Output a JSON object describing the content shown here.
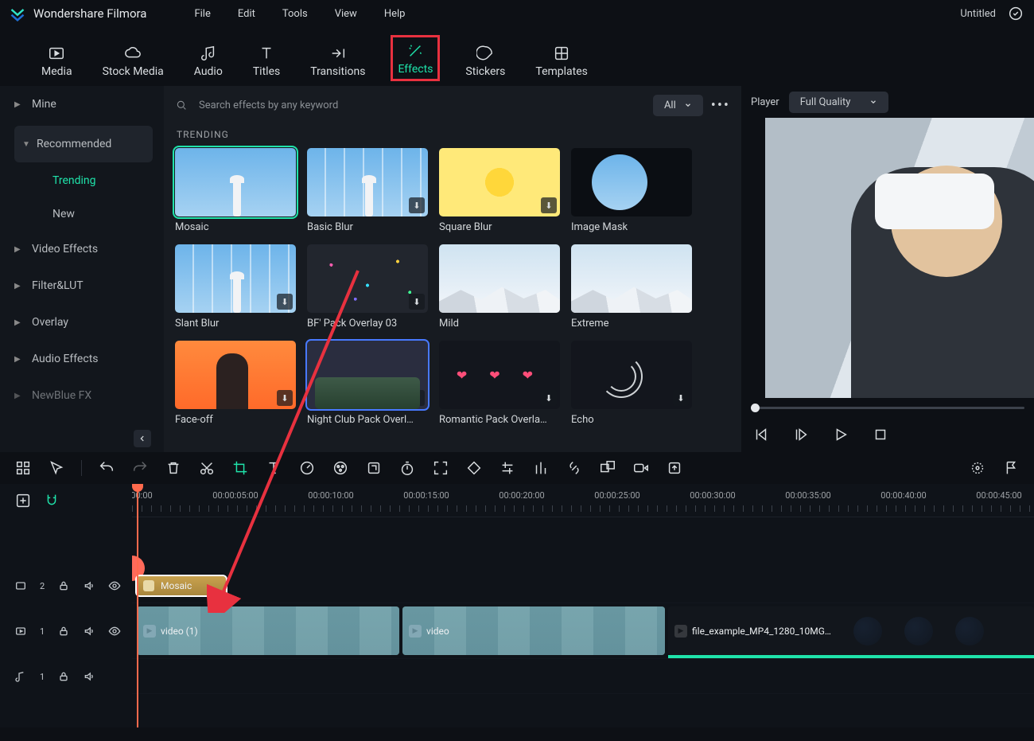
{
  "app": {
    "name": "Wondershare Filmora",
    "project_title": "Untitled"
  },
  "menus": [
    "File",
    "Edit",
    "Tools",
    "View",
    "Help"
  ],
  "nav_tabs": [
    {
      "id": "media",
      "label": "Media"
    },
    {
      "id": "stock",
      "label": "Stock Media"
    },
    {
      "id": "audio",
      "label": "Audio"
    },
    {
      "id": "titles",
      "label": "Titles"
    },
    {
      "id": "transitions",
      "label": "Transitions"
    },
    {
      "id": "effects",
      "label": "Effects"
    },
    {
      "id": "stickers",
      "label": "Stickers"
    },
    {
      "id": "templates",
      "label": "Templates"
    }
  ],
  "nav_active": "effects",
  "sidebar": {
    "categories": [
      {
        "id": "mine",
        "label": "Mine",
        "expanded": false
      },
      {
        "id": "recommended",
        "label": "Recommended",
        "expanded": true,
        "children": [
          {
            "id": "trending",
            "label": "Trending",
            "active": true
          },
          {
            "id": "new",
            "label": "New",
            "active": false
          }
        ]
      },
      {
        "id": "video-effects",
        "label": "Video Effects"
      },
      {
        "id": "filter-lut",
        "label": "Filter&LUT"
      },
      {
        "id": "overlay",
        "label": "Overlay"
      },
      {
        "id": "audio-effects",
        "label": "Audio Effects"
      },
      {
        "id": "newblue",
        "label": "NewBlue FX"
      }
    ]
  },
  "search": {
    "placeholder": "Search effects by any keyword"
  },
  "filter": {
    "label": "All"
  },
  "section": {
    "label": "TRENDING"
  },
  "effects": [
    {
      "id": "mosaic",
      "label": "Mosaic",
      "selected": true,
      "downloadable": false,
      "thumb": "sky"
    },
    {
      "id": "basic-blur",
      "label": "Basic Blur",
      "downloadable": true,
      "thumb": "sky blurstripe"
    },
    {
      "id": "square-blur",
      "label": "Square Blur",
      "downloadable": true,
      "thumb": "flower"
    },
    {
      "id": "image-mask",
      "label": "Image Mask",
      "downloadable": false,
      "thumb": "dark circleimg"
    },
    {
      "id": "slant-blur",
      "label": "Slant Blur",
      "downloadable": true,
      "thumb": "sky blurstripe"
    },
    {
      "id": "bf-pack",
      "label": "BF' Pack Overlay 03",
      "downloadable": true,
      "thumb": "confetti"
    },
    {
      "id": "mild",
      "label": "Mild",
      "downloadable": false,
      "thumb": "mount"
    },
    {
      "id": "extreme",
      "label": "Extreme",
      "downloadable": false,
      "thumb": "mount"
    },
    {
      "id": "face-off",
      "label": "Face-off",
      "downloadable": true,
      "thumb": "orange"
    },
    {
      "id": "night-club",
      "label": "Night Club Pack Overl…",
      "downloadable": true,
      "thumb": "night",
      "hl": true
    },
    {
      "id": "romantic",
      "label": "Romantic Pack Overla…",
      "downloadable": true,
      "thumb": "hearts"
    },
    {
      "id": "echo",
      "label": "Echo",
      "downloadable": true,
      "thumb": "echo"
    }
  ],
  "player": {
    "label": "Player",
    "quality_label": "Full Quality"
  },
  "timeline": {
    "timecodes": [
      "00:00",
      "00:00:05:00",
      "00:00:10:00",
      "00:00:15:00",
      "00:00:20:00",
      "00:00:25:00",
      "00:00:30:00",
      "00:00:35:00",
      "00:00:40:00",
      "00:00:45:00"
    ],
    "effect_clip": {
      "label": "Mosaic"
    },
    "video_clips": [
      {
        "label": "video (1)"
      },
      {
        "label": "video"
      },
      {
        "label": "file_example_MP4_1280_10MG…"
      }
    ],
    "track_labels": {
      "fx": "2",
      "v1": "1",
      "a1": "1"
    }
  }
}
